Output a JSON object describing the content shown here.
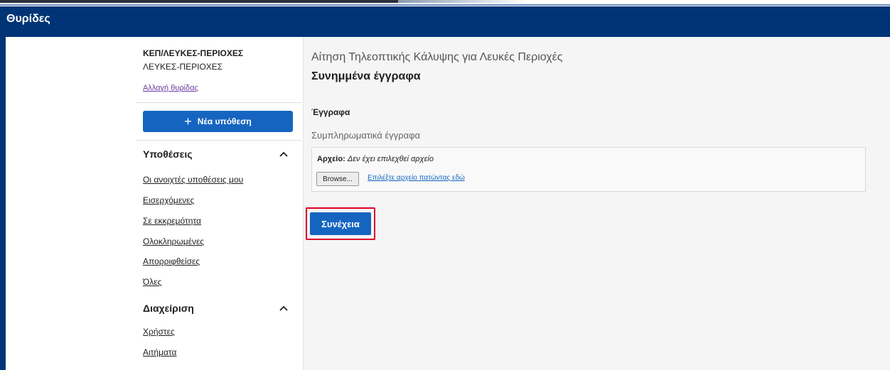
{
  "header": {
    "title": "Θυρίδες"
  },
  "sidebar": {
    "org_title": "ΚΕΠ/ΛΕΥΚΕΣ-ΠΕΡΙΟΧΕΣ",
    "org_subtitle": "ΛΕΥΚΕΣ-ΠΕΡΙΟΧΕΣ",
    "change_link": "Αλλαγή θυρίδας",
    "new_case_button": "Νέα υπόθεση",
    "sections": [
      {
        "label": "Υποθέσεις",
        "icon": "chevron-up-icon",
        "items": [
          "Οι ανοιχτές υποθέσεις μου",
          "Εισερχόμενες",
          "Σε εκκρεμότητα",
          "Ολοκληρωμένες",
          "Απορριφθείσες",
          "Όλες"
        ]
      },
      {
        "label": "Διαχείριση",
        "icon": "chevron-up-icon",
        "items": [
          "Χρήστες",
          "Αιτήματα"
        ]
      }
    ]
  },
  "main": {
    "subtitle": "Αίτηση Τηλεοπτικής Κάλυψης για Λευκές Περιοχές",
    "title": "Συνημμένα έγγραφα",
    "section_label": "Έγγραφα",
    "field_label": "Συμπληρωματικά έγγραφα",
    "file": {
      "label": "Αρχείο:",
      "value": "Δεν έχει επιλεχθεί αρχείο",
      "browse": "Browse...",
      "choose_link": "Επιλέξτε αρχείο πατώντας εδώ"
    },
    "continue_button": "Συνέχεια"
  },
  "colors": {
    "header_bg": "#003476",
    "primary_button": "#1565c0",
    "highlight_border": "#e0002a"
  }
}
